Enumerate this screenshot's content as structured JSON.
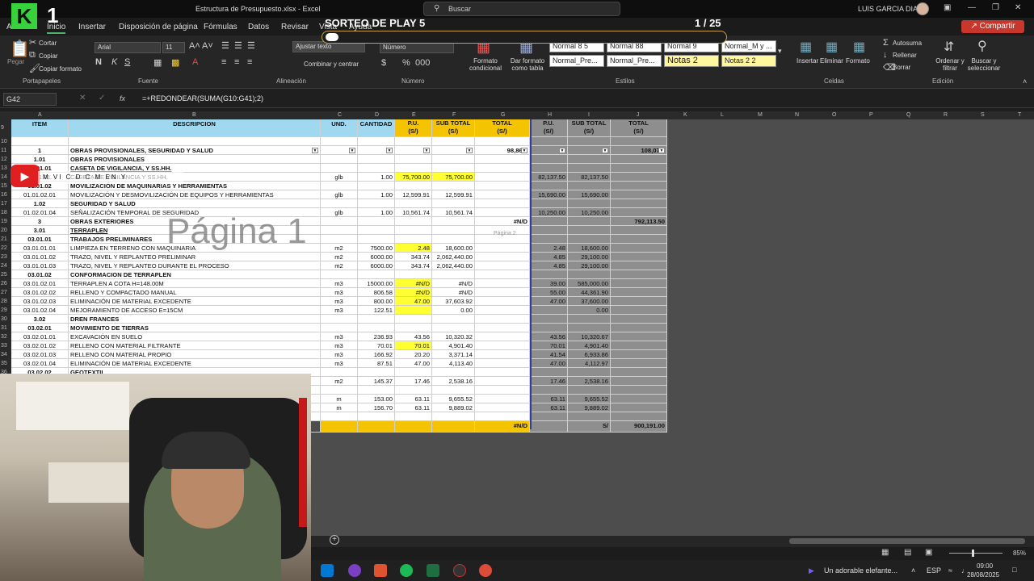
{
  "window": {
    "file_title": "Estructura de Presupuesto.xlsx - Excel",
    "search_placeholder": "Buscar",
    "user": "LUIS GARCIA DIAZ"
  },
  "overlay": {
    "logo_letter": "K",
    "logo_num": "1",
    "sorteo_title": "SORTEO DE PLAY 5",
    "sorteo_page": "1 / 25",
    "page_watermark": "Página 1",
    "page_watermark2": "Página 2",
    "youtube_banner": "M VI C D C M EN Y"
  },
  "tabs": [
    "Archivo",
    "Inicio",
    "Insertar",
    "Disposición de página",
    "Fórmulas",
    "Datos",
    "Revisar",
    "Vista",
    "Ayuda"
  ],
  "share": "Compartir",
  "ribbon": {
    "paste": "Pegar",
    "cut": "Cortar",
    "copy": "Copiar",
    "format_painter": "Copiar formato",
    "clipboard": "Portapapeles",
    "font_name": "Arial",
    "font_size": "11",
    "font": "Fuente",
    "wrap_text": "Ajustar texto",
    "merge": "Combinar y centrar",
    "alignment": "Alineación",
    "number_format": "Número",
    "number": "Número",
    "cond_format": "Formato condicional",
    "format_table": "Dar formato como tabla",
    "styles": "Estilos",
    "style_cells": [
      "Normal 8 5",
      "Normal 88",
      "Normal 9",
      "Normal_M y ...",
      "Normal_Pre...",
      "Normal_Pre...",
      "Notas 2",
      "Notas 2 2"
    ],
    "insert": "Insertar",
    "delete": "Eliminar",
    "format": "Formato",
    "cells": "Celdas",
    "autosum": "Autosuma",
    "fill": "Rellenar",
    "clear": "Borrar",
    "sort_filter": "Ordenar y filtrar",
    "find_select": "Buscar y seleccionar",
    "editing": "Edición"
  },
  "formula_bar": {
    "cell": "G42",
    "formula": "=+REDONDEAR(SUMA(G10:G41);2)"
  },
  "columns": [
    "A",
    "B",
    "C",
    "D",
    "E",
    "F",
    "G",
    "H",
    "I",
    "J",
    "K",
    "L",
    "M",
    "N",
    "O",
    "P",
    "Q",
    "R",
    "S",
    "T"
  ],
  "table_header": {
    "item": "ITEM",
    "desc": "DESCRIPCION",
    "und": "UND.",
    "cant": "CANTIDAD",
    "pu": "P.U.",
    "pu_unit": "(S/)",
    "sub": "SUB TOTAL",
    "sub_unit": "(S/)",
    "total": "TOTAL",
    "total_unit": "(S/)",
    "h_pu": "P.U.",
    "h_unit": "(S/)",
    "i_sub": "SUB TOTAL",
    "i_unit": "(S/)",
    "j_total": "TOTAL",
    "j_unit": "(S/)"
  },
  "rows": [
    {
      "n": "8",
      "item": "",
      "desc": "",
      "und": "",
      "cant": "",
      "pu": "",
      "sub": "",
      "total": "",
      "h": "",
      "i": "",
      "j": ""
    },
    {
      "n": "9",
      "item": "",
      "desc": "",
      "und": "",
      "cant": "",
      "pu": "",
      "sub": "",
      "total": "",
      "h": "",
      "i": "",
      "j": ""
    },
    {
      "n": "10",
      "item": "",
      "desc": "",
      "und": "",
      "cant": "",
      "pu": "",
      "sub": "",
      "total": "",
      "h": "",
      "i": "",
      "j": ""
    },
    {
      "n": "11",
      "item": "1",
      "desc": "OBRAS PROVISIONALES, SEGURIDAD Y SALUD",
      "und": "",
      "cant": "",
      "pu": "",
      "sub": "",
      "total": "98,861.",
      "h": "",
      "i": "",
      "j": "108,077."
    },
    {
      "n": "12",
      "item": "1.01",
      "desc": "OBRAS PROVISIONALES",
      "und": "",
      "cant": "",
      "pu": "",
      "sub": "",
      "total": "",
      "h": "",
      "i": "",
      "j": ""
    },
    {
      "n": "13",
      "item": "01.01.01",
      "desc": "CASETA DE VIGILANCIA, Y SS.HH.",
      "und": "",
      "cant": "",
      "pu": "",
      "sub": "",
      "total": "",
      "h": "",
      "i": "",
      "j": ""
    },
    {
      "n": "14",
      "item": "01.01.01.",
      "desc": "CASETA DE VIGILANCIA Y SS.HH.",
      "und": "glb",
      "cant": "1.00",
      "pu": "75,700.00",
      "sub": "75,700.00",
      "total": "",
      "h": "82,137.50",
      "i": "82,137.50",
      "j": ""
    },
    {
      "n": "15",
      "item": "01.01.02",
      "desc": "MOVILIZACIÓN DE MAQUINARIAS Y HERRAMIENTAS",
      "und": "",
      "cant": "",
      "pu": "",
      "sub": "",
      "total": "",
      "h": "",
      "i": "",
      "j": ""
    },
    {
      "n": "16",
      "item": "01.01.02.01",
      "desc": "MOVILIZACIÓN Y DESMOVILIZACIÓN DE EQUIPOS Y HERRAMIENTAS",
      "und": "glb",
      "cant": "1.00",
      "pu": "12,599.91",
      "sub": "12,599.91",
      "total": "",
      "h": "15,690.00",
      "i": "15,690.00",
      "j": ""
    },
    {
      "n": "17",
      "item": "1.02",
      "desc": "SEGURIDAD Y SALUD",
      "und": "",
      "cant": "",
      "pu": "",
      "sub": "",
      "total": "",
      "h": "",
      "i": "",
      "j": ""
    },
    {
      "n": "18",
      "item": "01.02.01.04",
      "desc": "SEÑALIZACIÓN TEMPORAL DE SEGURIDAD",
      "und": "glb",
      "cant": "1.00",
      "pu": "10,561.74",
      "sub": "10,561.74",
      "total": "",
      "h": "10,250.00",
      "i": "10,250.00",
      "j": ""
    },
    {
      "n": "19",
      "item": "3",
      "desc": "OBRAS EXTERIORES",
      "und": "",
      "cant": "",
      "pu": "",
      "sub": "",
      "total": "#N/D",
      "h": "",
      "i": "",
      "j": "792,113.50"
    },
    {
      "n": "20",
      "item": "3.01",
      "desc": "TERRAPLEN",
      "und": "",
      "cant": "",
      "pu": "",
      "sub": "",
      "total": "",
      "h": "",
      "i": "",
      "j": ""
    },
    {
      "n": "21",
      "item": "03.01.01",
      "desc": "TRABAJOS PRELIMINARES",
      "und": "",
      "cant": "",
      "pu": "",
      "sub": "",
      "total": "",
      "h": "",
      "i": "",
      "j": ""
    },
    {
      "n": "22",
      "item": "03.01.01.01",
      "desc": "LIMPIEZA EN TERRENO CON MAQUINARIA",
      "und": "m2",
      "cant": "7500.00",
      "pu": "2.48",
      "sub": "18,600.00",
      "total": "",
      "h": "2.48",
      "i": "18,600.00",
      "j": ""
    },
    {
      "n": "23",
      "item": "03.01.01.02",
      "desc": "TRAZO, NIVEL Y REPLANTEO PRELIMINAR",
      "und": "m2",
      "cant": "6000.00",
      "pu": "343.74",
      "sub": "2,062,440.00",
      "total": "",
      "h": "4.85",
      "i": "29,100.00",
      "j": ""
    },
    {
      "n": "24",
      "item": "03.01.01.03",
      "desc": "TRAZO, NIVEL Y REPLANTEO DURANTE EL PROCESO",
      "und": "m2",
      "cant": "6000.00",
      "pu": "343.74",
      "sub": "2,062,440.00",
      "total": "",
      "h": "4.85",
      "i": "29,100.00",
      "j": ""
    },
    {
      "n": "25",
      "item": "03.01.02",
      "desc": "CONFORMACION DE TERRAPLEN",
      "und": "",
      "cant": "",
      "pu": "",
      "sub": "",
      "total": "",
      "h": "",
      "i": "",
      "j": ""
    },
    {
      "n": "26",
      "item": "03.01.02.01",
      "desc": "TERRAPLEN A COTA H=148.00M",
      "und": "m3",
      "cant": "15000.00",
      "pu": "#N/D",
      "sub": "#N/D",
      "total": "",
      "h": "39.00",
      "i": "585,000.00",
      "j": ""
    },
    {
      "n": "27",
      "item": "03.01.02.02",
      "desc": "RELLENO Y COMPACTADO MANUAL",
      "und": "m3",
      "cant": "806.58",
      "pu": "#N/D",
      "sub": "#N/D",
      "total": "",
      "h": "55.00",
      "i": "44,361.90",
      "j": ""
    },
    {
      "n": "28",
      "item": "03.01.02.03",
      "desc": "ELIMINACIÓN DE MATERIAL EXCEDENTE",
      "und": "m3",
      "cant": "800.00",
      "pu": "47.00",
      "sub": "37,603.92",
      "total": "",
      "h": "47.00",
      "i": "37,600.00",
      "j": ""
    },
    {
      "n": "29",
      "item": "03.01.02.04",
      "desc": "MEJORAMIENTO DE ACCESO E=15CM",
      "und": "m3",
      "cant": "122.51",
      "pu": "",
      "sub": "0.00",
      "total": "",
      "h": "",
      "i": "0.00",
      "j": ""
    },
    {
      "n": "30",
      "item": "3.02",
      "desc": "DREN FRANCES",
      "und": "",
      "cant": "",
      "pu": "",
      "sub": "",
      "total": "",
      "h": "",
      "i": "",
      "j": ""
    },
    {
      "n": "31",
      "item": "03.02.01",
      "desc": "MOVIMIENTO DE TIERRAS",
      "und": "",
      "cant": "",
      "pu": "",
      "sub": "",
      "total": "",
      "h": "",
      "i": "",
      "j": ""
    },
    {
      "n": "32",
      "item": "03.02.01.01",
      "desc": "EXCAVACIÓN EN SUELO",
      "und": "m3",
      "cant": "236.93",
      "pu": "43.56",
      "sub": "10,320.32",
      "total": "",
      "h": "43.56",
      "i": "10,320.67",
      "j": ""
    },
    {
      "n": "33",
      "item": "03.02.01.02",
      "desc": "RELLENO CON MATERIAL FILTRANTE",
      "und": "m3",
      "cant": "70.01",
      "pu": "70.01",
      "sub": "4,901.40",
      "total": "",
      "h": "70.01",
      "i": "4,901.40",
      "j": ""
    },
    {
      "n": "34",
      "item": "03.02.01.03",
      "desc": "RELLENO CON MATERIAL PROPIO",
      "und": "m3",
      "cant": "166.92",
      "pu": "20.20",
      "sub": "3,371.14",
      "total": "",
      "h": "41.54",
      "i": "6,933.86",
      "j": ""
    },
    {
      "n": "35",
      "item": "03.02.01.04",
      "desc": "ELIMINACIÓN DE MATERIAL EXCEDENTE",
      "und": "m3",
      "cant": "87.51",
      "pu": "47.00",
      "sub": "4,113.40",
      "total": "",
      "h": "47.00",
      "i": "4,112.97",
      "j": ""
    },
    {
      "n": "36",
      "item": "03.02.02",
      "desc": "GEOTEXTIL",
      "und": "",
      "cant": "",
      "pu": "",
      "sub": "",
      "total": "",
      "h": "",
      "i": "",
      "j": ""
    },
    {
      "n": "37",
      "item": "",
      "desc": "",
      "und": "m2",
      "cant": "145.37",
      "pu": "17.46",
      "sub": "2,538.16",
      "total": "",
      "h": "17.46",
      "i": "2,538.16",
      "j": ""
    },
    {
      "n": "38",
      "item": "",
      "desc": "",
      "und": "",
      "cant": "",
      "pu": "",
      "sub": "",
      "total": "",
      "h": "",
      "i": "",
      "j": ""
    },
    {
      "n": "39",
      "item": "",
      "desc": "",
      "und": "m",
      "cant": "153.00",
      "pu": "63.11",
      "sub": "9,655.52",
      "total": "",
      "h": "63.11",
      "i": "9,655.52",
      "j": ""
    },
    {
      "n": "40",
      "item": "",
      "desc": "",
      "und": "m",
      "cant": "156.70",
      "pu": "63.11",
      "sub": "9,889.02",
      "total": "",
      "h": "63.11",
      "i": "9,889.02",
      "j": ""
    },
    {
      "n": "41",
      "item": "",
      "desc": "",
      "und": "",
      "cant": "",
      "pu": "",
      "sub": "",
      "total": "",
      "h": "",
      "i": "",
      "j": ""
    },
    {
      "n": "42",
      "item": "",
      "desc": "",
      "und": "",
      "cant": "",
      "pu": "",
      "sub": "",
      "total": "#N/D",
      "h": "",
      "i": "S/",
      "j": "900,191.00"
    }
  ],
  "status": {
    "zoom": "85%"
  },
  "taskbar": {
    "media": "Un adorable elefante...",
    "lang": "ESP",
    "time": "09:00",
    "date": "28/08/2025"
  },
  "colors": {
    "accent_green": "#4fb26c",
    "highlight_yellow": "#ffff33",
    "header_blue": "#a0d8f0",
    "header_gold": "#f5c400",
    "share_red": "#c9372c"
  }
}
